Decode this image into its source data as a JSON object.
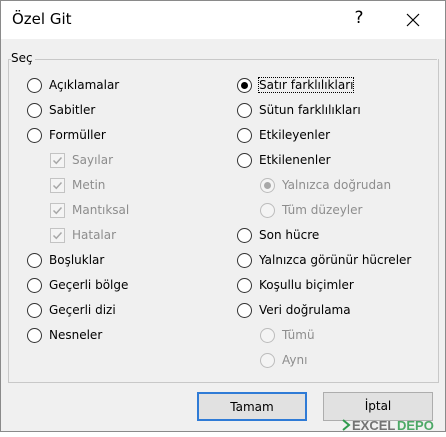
{
  "dialog": {
    "title": "Özel Git",
    "help_symbol": "?"
  },
  "group": {
    "label": "Seç"
  },
  "left_options": [
    {
      "label": "Açıklamalar",
      "checked": false
    },
    {
      "label": "Sabitler",
      "checked": false
    },
    {
      "label": "Formüller",
      "checked": false
    },
    {
      "label": "Sayılar",
      "disabled": true,
      "checked": true
    },
    {
      "label": "Metin",
      "disabled": true,
      "checked": true
    },
    {
      "label": "Mantıksal",
      "disabled": true,
      "checked": true
    },
    {
      "label": "Hatalar",
      "disabled": true,
      "checked": true
    },
    {
      "label": "Boşluklar",
      "checked": false
    },
    {
      "label": "Geçerli bölge",
      "checked": false
    },
    {
      "label": "Geçerli dizi",
      "checked": false
    },
    {
      "label": "Nesneler",
      "checked": false
    }
  ],
  "right_options": [
    {
      "label": "Satır farklılıkları",
      "checked": true
    },
    {
      "label": "Sütun farklılıkları",
      "checked": false
    },
    {
      "label": "Etkileyenler",
      "checked": false
    },
    {
      "label": "Etkilenenler",
      "checked": false
    },
    {
      "label": "Yalnızca doğrudan",
      "disabled": true,
      "checked": true
    },
    {
      "label": "Tüm düzeyler",
      "disabled": true,
      "checked": false
    },
    {
      "label": "Son hücre",
      "checked": false
    },
    {
      "label": "Yalnızca görünür hücreler",
      "checked": false
    },
    {
      "label": "Koşullu biçimler",
      "checked": false
    },
    {
      "label": "Veri doğrulama",
      "checked": false
    },
    {
      "label": "Tümü",
      "disabled": true,
      "checked": false
    },
    {
      "label": "Aynı",
      "disabled": true,
      "checked": false
    }
  ],
  "buttons": {
    "ok": "Tamam",
    "cancel": "İptal"
  },
  "watermark": {
    "text": "EXCELDEPO"
  },
  "colors": {
    "accent": "#2f7bd6",
    "dialog_bg": "#f0f0f0",
    "disabled_text": "#8d8d8d"
  }
}
